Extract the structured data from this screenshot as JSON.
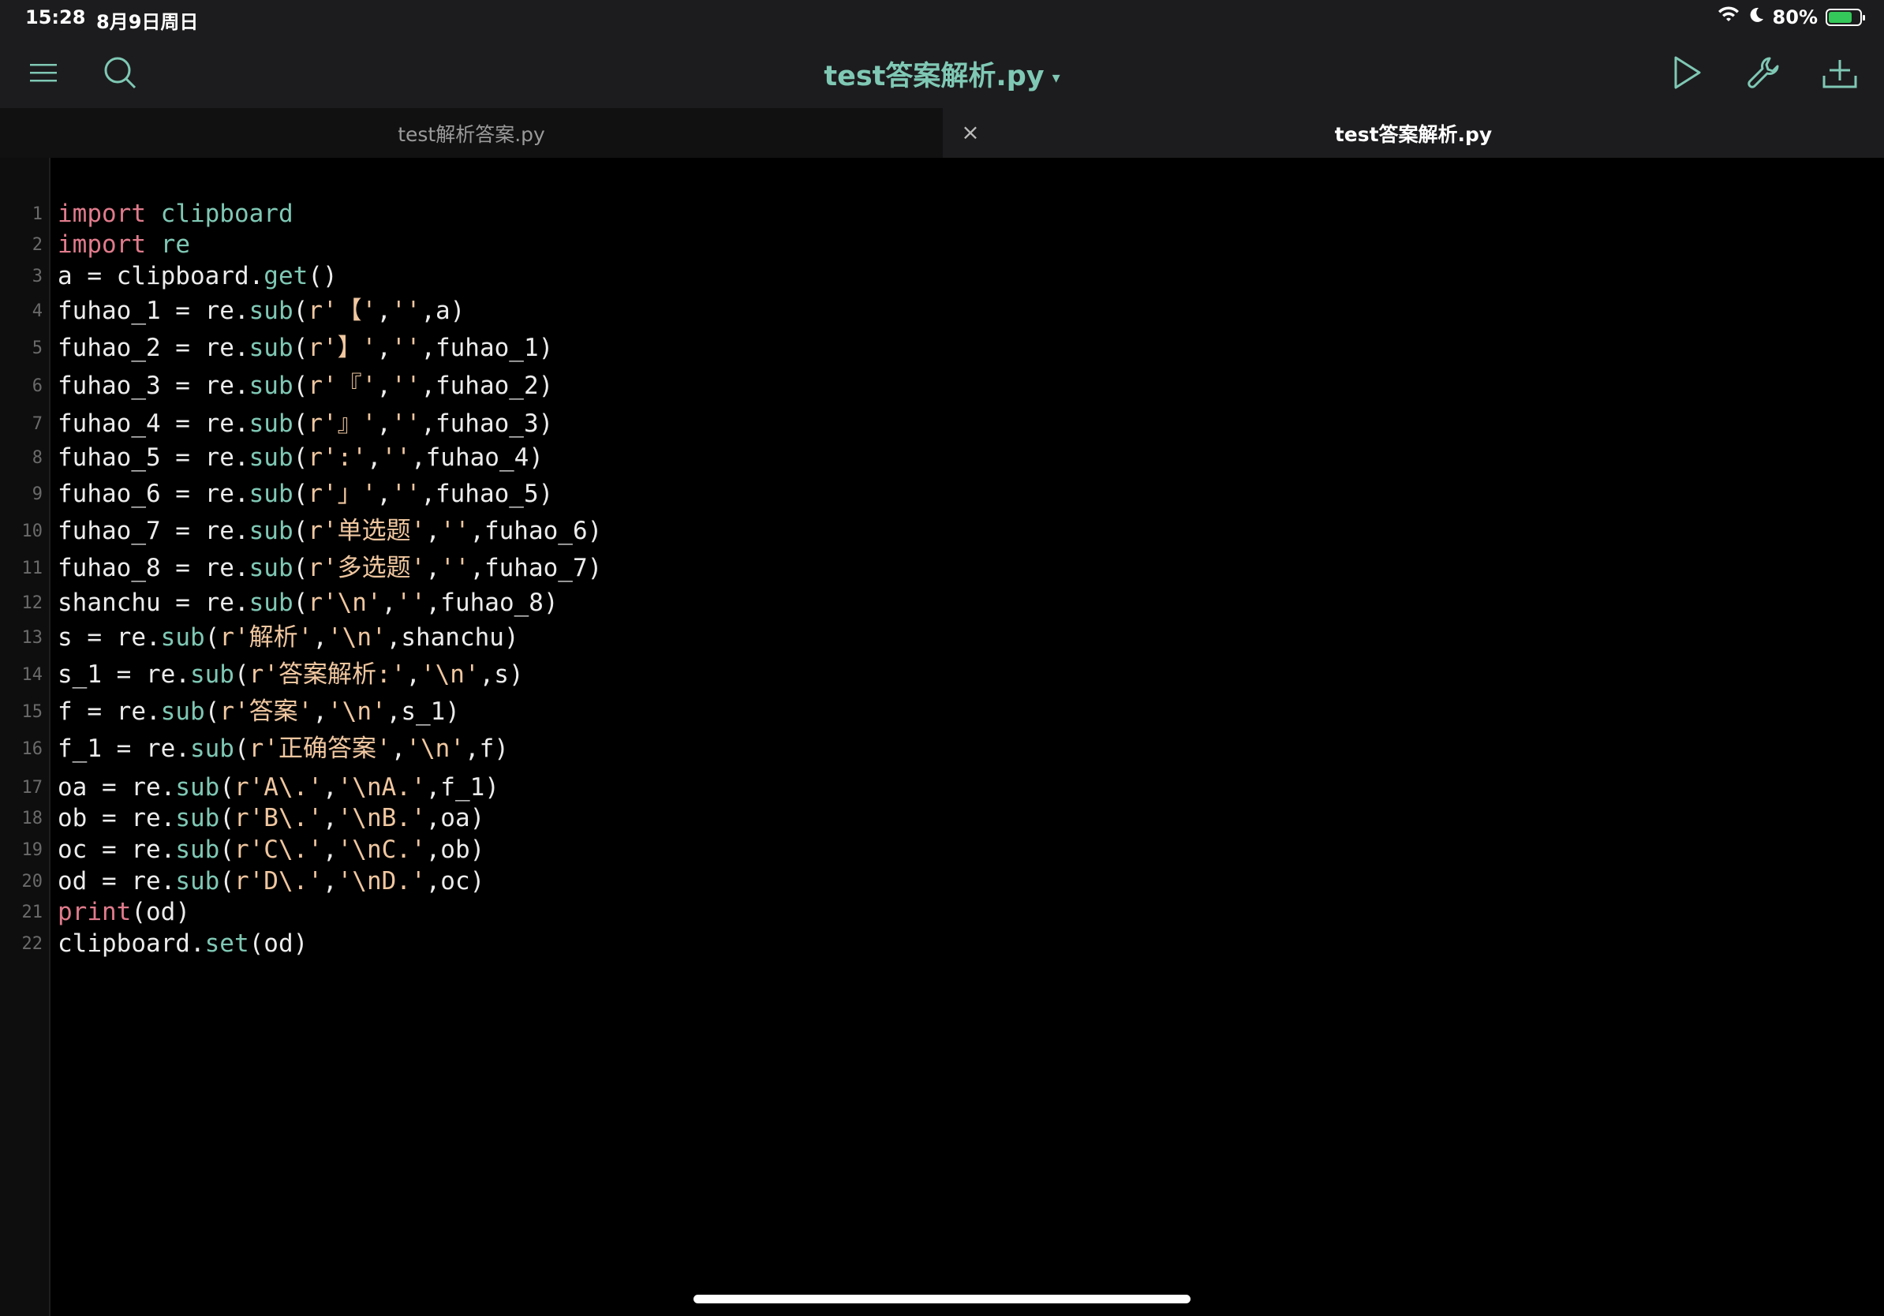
{
  "status": {
    "time": "15:28",
    "date": "8月9日周日",
    "battery": "80%",
    "battery_level": 0.8
  },
  "toolbar": {
    "title": "test答案解析.py",
    "title_caret": "▾",
    "icons": [
      "menu-icon",
      "search-icon",
      "play-icon",
      "wrench-icon",
      "add-file-icon"
    ]
  },
  "tabs": [
    {
      "label": "test解析答案.py",
      "active": false
    },
    {
      "label": "test答案解析.py",
      "active": true
    }
  ],
  "tab_close_glyph": "×",
  "code_lines": [
    {
      "n": "1",
      "t": [
        [
          "kw",
          "import"
        ],
        [
          "p",
          " "
        ],
        [
          "mod",
          "clipboard"
        ]
      ]
    },
    {
      "n": "2",
      "t": [
        [
          "kw",
          "import"
        ],
        [
          "p",
          " "
        ],
        [
          "mod",
          "re"
        ]
      ]
    },
    {
      "n": "3",
      "t": [
        [
          "p",
          "a = clipboard."
        ],
        [
          "fn",
          "get"
        ],
        [
          "p",
          "()"
        ]
      ]
    },
    {
      "n": "4",
      "t": [
        [
          "p",
          "fuhao_1 = re."
        ],
        [
          "fn",
          "sub"
        ],
        [
          "p",
          "("
        ],
        [
          "str",
          "r'【'"
        ],
        [
          "p",
          ","
        ],
        [
          "str",
          "''"
        ],
        [
          "p",
          ",a)"
        ]
      ]
    },
    {
      "n": "5",
      "t": [
        [
          "p",
          "fuhao_2 = re."
        ],
        [
          "fn",
          "sub"
        ],
        [
          "p",
          "("
        ],
        [
          "str",
          "r'】'"
        ],
        [
          "p",
          ","
        ],
        [
          "str",
          "''"
        ],
        [
          "p",
          ",fuhao_1)"
        ]
      ]
    },
    {
      "n": "6",
      "t": [
        [
          "p",
          "fuhao_3 = re."
        ],
        [
          "fn",
          "sub"
        ],
        [
          "p",
          "("
        ],
        [
          "str",
          "r'『'"
        ],
        [
          "p",
          ","
        ],
        [
          "str",
          "''"
        ],
        [
          "p",
          ",fuhao_2)"
        ]
      ]
    },
    {
      "n": "7",
      "t": [
        [
          "p",
          "fuhao_4 = re."
        ],
        [
          "fn",
          "sub"
        ],
        [
          "p",
          "("
        ],
        [
          "str",
          "r'』'"
        ],
        [
          "p",
          ","
        ],
        [
          "str",
          "''"
        ],
        [
          "p",
          ",fuhao_3)"
        ]
      ]
    },
    {
      "n": "8",
      "t": [
        [
          "p",
          "fuhao_5 = re."
        ],
        [
          "fn",
          "sub"
        ],
        [
          "p",
          "("
        ],
        [
          "str",
          "r':'"
        ],
        [
          "p",
          ","
        ],
        [
          "str",
          "''"
        ],
        [
          "p",
          ",fuhao_4)"
        ]
      ]
    },
    {
      "n": "9",
      "t": [
        [
          "p",
          "fuhao_6 = re."
        ],
        [
          "fn",
          "sub"
        ],
        [
          "p",
          "("
        ],
        [
          "str",
          "r'」'"
        ],
        [
          "p",
          ","
        ],
        [
          "str",
          "''"
        ],
        [
          "p",
          ",fuhao_5)"
        ]
      ]
    },
    {
      "n": "10",
      "t": [
        [
          "p",
          "fuhao_7 = re."
        ],
        [
          "fn",
          "sub"
        ],
        [
          "p",
          "("
        ],
        [
          "str",
          "r'单选题'"
        ],
        [
          "p",
          ","
        ],
        [
          "str",
          "''"
        ],
        [
          "p",
          ",fuhao_6)"
        ]
      ]
    },
    {
      "n": "11",
      "t": [
        [
          "p",
          "fuhao_8 = re."
        ],
        [
          "fn",
          "sub"
        ],
        [
          "p",
          "("
        ],
        [
          "str",
          "r'多选题'"
        ],
        [
          "p",
          ","
        ],
        [
          "str",
          "''"
        ],
        [
          "p",
          ",fuhao_7)"
        ]
      ]
    },
    {
      "n": "12",
      "t": [
        [
          "p",
          "shanchu = re."
        ],
        [
          "fn",
          "sub"
        ],
        [
          "p",
          "("
        ],
        [
          "str",
          "r'\\n'"
        ],
        [
          "p",
          ","
        ],
        [
          "str",
          "''"
        ],
        [
          "p",
          ",fuhao_8)"
        ]
      ]
    },
    {
      "n": "13",
      "t": [
        [
          "p",
          "s = re."
        ],
        [
          "fn",
          "sub"
        ],
        [
          "p",
          "("
        ],
        [
          "str",
          "r'解析'"
        ],
        [
          "p",
          ","
        ],
        [
          "str",
          "'\\n'"
        ],
        [
          "p",
          ",shanchu)"
        ]
      ]
    },
    {
      "n": "14",
      "t": [
        [
          "p",
          "s_1 = re."
        ],
        [
          "fn",
          "sub"
        ],
        [
          "p",
          "("
        ],
        [
          "str",
          "r'答案解析:'"
        ],
        [
          "p",
          ","
        ],
        [
          "str",
          "'\\n'"
        ],
        [
          "p",
          ",s)"
        ]
      ]
    },
    {
      "n": "15",
      "t": [
        [
          "p",
          "f = re."
        ],
        [
          "fn",
          "sub"
        ],
        [
          "p",
          "("
        ],
        [
          "str",
          "r'答案'"
        ],
        [
          "p",
          ","
        ],
        [
          "str",
          "'\\n'"
        ],
        [
          "p",
          ",s_1)"
        ]
      ]
    },
    {
      "n": "16",
      "t": [
        [
          "p",
          "f_1 = re."
        ],
        [
          "fn",
          "sub"
        ],
        [
          "p",
          "("
        ],
        [
          "str",
          "r'正确答案'"
        ],
        [
          "p",
          ","
        ],
        [
          "str",
          "'\\n'"
        ],
        [
          "p",
          ",f)"
        ]
      ]
    },
    {
      "n": "17",
      "t": [
        [
          "p",
          "oa = re."
        ],
        [
          "fn",
          "sub"
        ],
        [
          "p",
          "("
        ],
        [
          "str",
          "r'A\\.'"
        ],
        [
          "p",
          ","
        ],
        [
          "str",
          "'\\nA.'"
        ],
        [
          "p",
          ",f_1)"
        ]
      ]
    },
    {
      "n": "18",
      "t": [
        [
          "p",
          "ob = re."
        ],
        [
          "fn",
          "sub"
        ],
        [
          "p",
          "("
        ],
        [
          "str",
          "r'B\\.'"
        ],
        [
          "p",
          ","
        ],
        [
          "str",
          "'\\nB.'"
        ],
        [
          "p",
          ",oa)"
        ]
      ]
    },
    {
      "n": "19",
      "t": [
        [
          "p",
          "oc = re."
        ],
        [
          "fn",
          "sub"
        ],
        [
          "p",
          "("
        ],
        [
          "str",
          "r'C\\.'"
        ],
        [
          "p",
          ","
        ],
        [
          "str",
          "'\\nC.'"
        ],
        [
          "p",
          ",ob)"
        ]
      ]
    },
    {
      "n": "20",
      "t": [
        [
          "p",
          "od = re."
        ],
        [
          "fn",
          "sub"
        ],
        [
          "p",
          "("
        ],
        [
          "str",
          "r'D\\.'"
        ],
        [
          "p",
          ","
        ],
        [
          "str",
          "'\\nD.'"
        ],
        [
          "p",
          ",oc)"
        ]
      ]
    },
    {
      "n": "21",
      "t": [
        [
          "kw",
          "print"
        ],
        [
          "p",
          "(od)"
        ]
      ]
    },
    {
      "n": "22",
      "t": [
        [
          "p",
          "clipboard."
        ],
        [
          "fn",
          "set"
        ],
        [
          "p",
          "(od)"
        ]
      ]
    }
  ],
  "colors": {
    "keyword": "#e07b8c",
    "module_fn": "#7fc8b4",
    "string": "#f0c7a0",
    "plain": "#ececec",
    "title": "#7fc8b4",
    "battery": "#34c759"
  }
}
